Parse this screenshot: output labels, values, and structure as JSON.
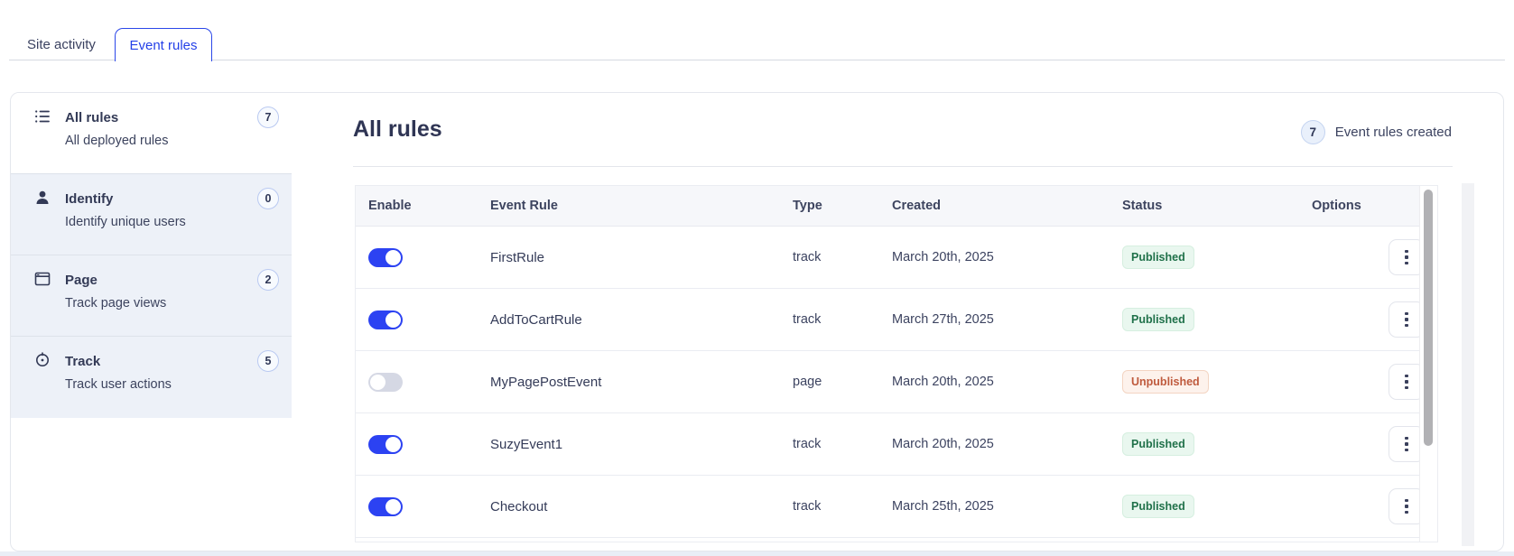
{
  "tabs": [
    {
      "label": "Site activity",
      "active": false
    },
    {
      "label": "Event rules",
      "active": true
    }
  ],
  "sidebar": {
    "items": [
      {
        "icon": "list-icon",
        "title": "All rules",
        "subtitle": "All deployed rules",
        "count": "7",
        "selected": true
      },
      {
        "icon": "user-icon",
        "title": "Identify",
        "subtitle": "Identify unique users",
        "count": "0",
        "selected": false
      },
      {
        "icon": "window-icon",
        "title": "Page",
        "subtitle": "Track page views",
        "count": "2",
        "selected": false
      },
      {
        "icon": "target-icon",
        "title": "Track",
        "subtitle": "Track user actions",
        "count": "5",
        "selected": false
      }
    ]
  },
  "main": {
    "title": "All rules",
    "summary": {
      "count": "7",
      "label": "Event rules created"
    },
    "table": {
      "columns": [
        "Enable",
        "Event Rule",
        "Type",
        "Created",
        "Status",
        "Options"
      ],
      "rows": [
        {
          "toggle": "on",
          "name": "FirstRule",
          "type": "track",
          "created": "March 20th, 2025",
          "status": "Published"
        },
        {
          "toggle": "on",
          "name": "AddToCartRule",
          "type": "track",
          "created": "March 27th, 2025",
          "status": "Published"
        },
        {
          "toggle": "off",
          "name": "MyPagePostEvent",
          "type": "page",
          "created": "March 20th, 2025",
          "status": "Unpublished"
        },
        {
          "toggle": "on",
          "name": "SuzyEvent1",
          "type": "track",
          "created": "March 20th, 2025",
          "status": "Published"
        },
        {
          "toggle": "on",
          "name": "Checkout",
          "type": "track",
          "created": "March 25th, 2025",
          "status": "Published"
        }
      ]
    }
  },
  "colors": {
    "accent_blue": "#2c42f2",
    "published_bg": "#e9f7ef",
    "published_text": "#20714a",
    "unpublished_bg": "#fdf2ec",
    "unpublished_text": "#bf5a3d",
    "sidebar_item_bg": "#edf1f8",
    "table_header_bg": "#f6f7fa",
    "text_navy": "#333a56"
  }
}
